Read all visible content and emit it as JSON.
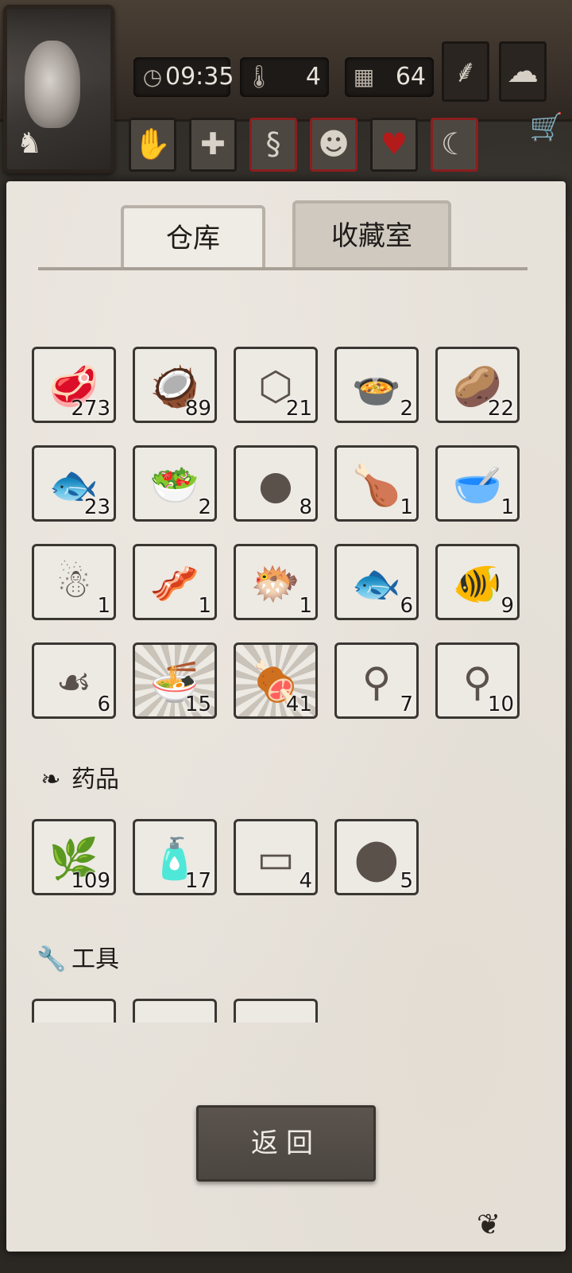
{
  "hud": {
    "time": "09:35",
    "temperature": "4",
    "day": "64",
    "icons": {
      "clock": "clock-icon",
      "thermometer": "thermometer-icon",
      "calendar": "calendar-icon",
      "sprout": "sprout-icon",
      "weather": "snow-cloud-icon",
      "cart": "cart-icon"
    }
  },
  "status_icons": [
    "hand-icon",
    "health-cross-icon",
    "stomach-icon",
    "head-icon",
    "heart-icon",
    "moon-icon"
  ],
  "tabs": [
    {
      "label": "仓库",
      "active": true
    },
    {
      "label": "收藏室",
      "active": false
    }
  ],
  "food_items": [
    {
      "icon": "meat-icon",
      "count": "273"
    },
    {
      "icon": "coconut-icon",
      "count": "89"
    },
    {
      "icon": "honeycomb-icon",
      "count": "21"
    },
    {
      "icon": "stew-bowl-icon",
      "count": "2"
    },
    {
      "icon": "potato-icon",
      "count": "22"
    },
    {
      "icon": "dried-fish-icon",
      "count": "23"
    },
    {
      "icon": "salad-bowl-icon",
      "count": "2"
    },
    {
      "icon": "berries-icon",
      "count": "8"
    },
    {
      "icon": "roast-chicken-icon",
      "count": "1"
    },
    {
      "icon": "soup-bowl-icon",
      "count": "1"
    },
    {
      "icon": "gingerbread-icon",
      "count": "1"
    },
    {
      "icon": "sausage-icon",
      "count": "1"
    },
    {
      "icon": "pufferfish-icon",
      "count": "1"
    },
    {
      "icon": "salmon-icon",
      "count": "6"
    },
    {
      "icon": "butterflyfish-icon",
      "count": "9"
    },
    {
      "icon": "jellyfish-icon",
      "count": "6"
    },
    {
      "icon": "hot-soup-icon",
      "count": "15"
    },
    {
      "icon": "grilled-steak-icon",
      "count": "41"
    },
    {
      "icon": "hanging-meat-icon",
      "count": "7"
    },
    {
      "icon": "hanging-meat-icon",
      "count": "10"
    }
  ],
  "sections": {
    "medicine": {
      "title": "药品",
      "icon": "leaf-icon"
    },
    "tools": {
      "title": "工具",
      "icon": "wrench-icon"
    }
  },
  "medicine_items": [
    {
      "icon": "herb-branch-icon",
      "count": "109"
    },
    {
      "icon": "tonic-bottle-icon",
      "count": "17"
    },
    {
      "icon": "bandage-icon",
      "count": "4"
    },
    {
      "icon": "pill-icon",
      "count": "5"
    }
  ],
  "tool_items": [
    {
      "icon": "tool-1-icon"
    },
    {
      "icon": "tool-2-icon"
    },
    {
      "icon": "tool-3-icon"
    }
  ],
  "back_button": "返回"
}
